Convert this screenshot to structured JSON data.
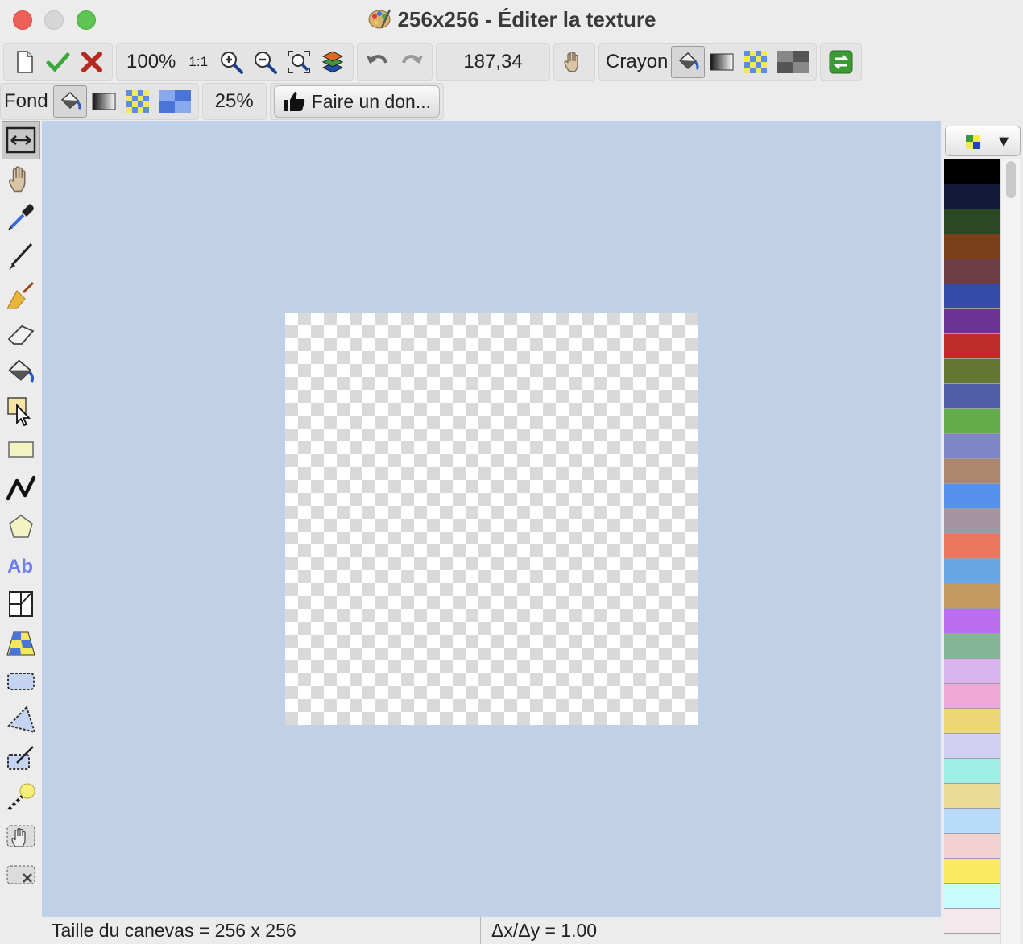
{
  "window": {
    "title": "256x256 - Éditer la texture"
  },
  "toolbar1": {
    "new_icon": "new-document-icon",
    "ok_icon": "checkmark-icon",
    "cancel_icon": "red-x-icon",
    "zoom": "100%",
    "one_to_one": "1:1",
    "coords": "187,34",
    "mode_label": "Crayon"
  },
  "toolbar2": {
    "bg_label": "Fond",
    "opacity": "25%",
    "donate_label": "Faire un don..."
  },
  "status": {
    "canvas_size": "Taille du canevas = 256 x 256",
    "ratio": "Δx/Δy = 1.00"
  },
  "palette": {
    "colors": [
      "#000000",
      "#121a38",
      "#2b4824",
      "#7a401a",
      "#6e3e48",
      "#344ca8",
      "#6c3396",
      "#be2c28",
      "#667634",
      "#5060a8",
      "#62ac4a",
      "#7e86c8",
      "#ad8670",
      "#5490ec",
      "#a594a2",
      "#ea7660",
      "#68a6e6",
      "#c49a62",
      "#bd6eee",
      "#82b696",
      "#dab4ee",
      "#f0a8d8",
      "#ecd676",
      "#d2d0f2",
      "#9ef0e6",
      "#eadc94",
      "#b8dcf8",
      "#f2d2d0",
      "#faea62",
      "#c6fcfc",
      "#f4e8ec"
    ]
  },
  "tools": [
    "resize",
    "hand",
    "eyedropper",
    "pencil",
    "broom",
    "eraser",
    "bucket",
    "select-arrow",
    "rectangle",
    "polyline",
    "polygon",
    "text",
    "perspective",
    "checker-floor",
    "selection",
    "lasso",
    "brush-select",
    "magic-wand",
    "grab",
    "delete-selection"
  ]
}
